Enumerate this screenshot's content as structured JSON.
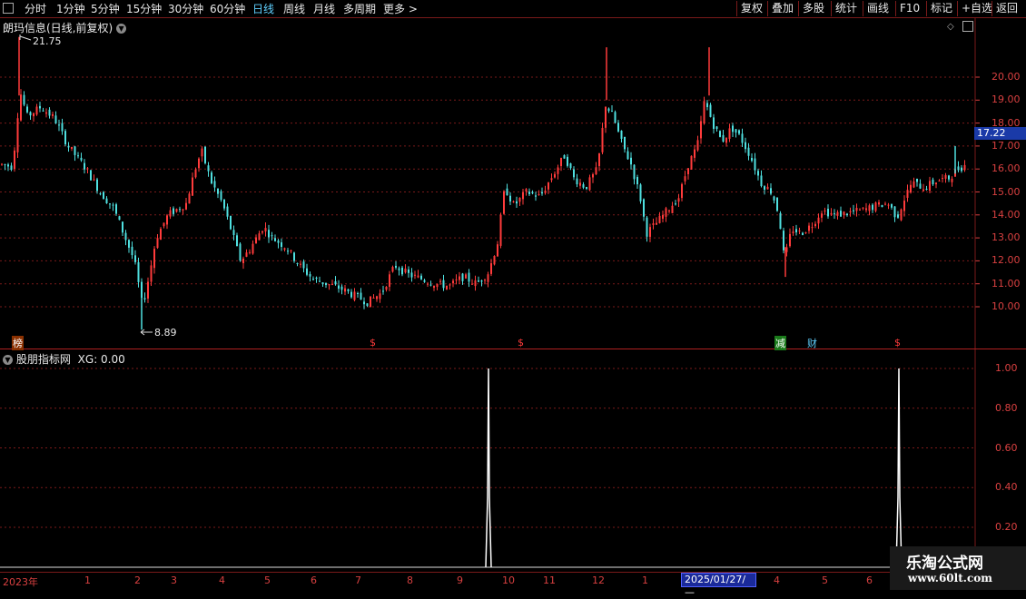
{
  "toolbar": {
    "periods": [
      "分时",
      "1分钟",
      "5分钟",
      "15分钟",
      "30分钟",
      "60分钟",
      "日线",
      "周线",
      "月线",
      "多周期",
      "更多 >"
    ],
    "active_period": "日线",
    "right_buttons": [
      "复权",
      "叠加",
      "多股",
      "统计",
      "画线",
      "F10",
      "标记",
      "+自选",
      "返回"
    ]
  },
  "main_panel": {
    "title": "朗玛信息(日线,前复权)",
    "high_label": "21.75",
    "low_label": "8.89",
    "current_price": "17.22",
    "y_ticks": [
      "20.00",
      "19.00",
      "18.00",
      "17.00",
      "16.00",
      "15.00",
      "14.00",
      "13.00",
      "12.00",
      "11.00",
      "10.00"
    ],
    "markers": {
      "bang": "榜",
      "s": "$",
      "jian": "减",
      "cai": "财"
    }
  },
  "indicator_panel": {
    "title": "股朋指标网",
    "value_text": "XG: 0.00",
    "y_ticks": [
      "1.00",
      "0.80",
      "0.60",
      "0.40",
      "0.20"
    ]
  },
  "time_axis": {
    "labels": [
      "2023年",
      "1",
      "2",
      "3",
      "4",
      "5",
      "6",
      "7",
      "8",
      "9",
      "10",
      "11",
      "12",
      "1",
      "4",
      "5",
      "6"
    ],
    "cursor_date": "2025/01/27/—"
  },
  "watermark": {
    "line1": "乐淘公式网",
    "line2": "www.60lt.com"
  },
  "colors": {
    "up": "#ff3b3b",
    "down": "#4fe0e0",
    "axis": "#d84040",
    "grid": "#7a1a1a"
  }
}
